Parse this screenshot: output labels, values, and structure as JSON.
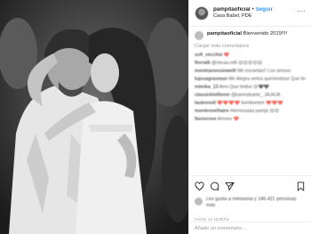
{
  "post": {
    "username": "pampitaoficial",
    "follow_label": "Seguir",
    "location": "Casa Babel, PDE",
    "caption_user": "pampitaoficial",
    "caption_text": "Bienvenido 2019!!!!",
    "load_more": "Cargar más comentarios",
    "likes_text": "Les gusta a mimaxina y 146.421 personas más",
    "timestamp": "HACE 11 HORAS",
    "comment_placeholder": "Añade un comentario..."
  },
  "comments": [
    {
      "user": "sofi_vecchio",
      "text": "❤️"
    },
    {
      "user": "florralli",
      "text": "@micaa.relli 😍😍😍😍😍"
    },
    {
      "user": "montepovosiowelll",
      "text": "Me encantan!! Los amooo"
    },
    {
      "user": "lujosagrasmun",
      "text": "Me Alegra verlos queriendose Que lindoo!! 🎉 felicidades!!!"
    },
    {
      "user": "mimika_13",
      "text": "Amo Que lindos 😍🖤🖤"
    },
    {
      "user": "classicklollieem",
      "text": "@karenduarte_ JAJAJA"
    },
    {
      "user": "lauleenoll",
      "text": "❤️❤️❤️❤️ bomboneer ❤️❤️❤️"
    },
    {
      "user": "montenoelhaire",
      "text": "Hermosaaa pareja 😍😍"
    },
    {
      "user": "favosrose",
      "text": "Amooo ❤️"
    }
  ],
  "icons": {
    "heart": "heart-icon",
    "comment": "comment-icon",
    "share": "share-icon",
    "save": "bookmark-icon",
    "more": "more-options-icon"
  },
  "colors": {
    "follow": "#3897f0",
    "text": "#262626",
    "muted": "#999999",
    "border": "#efefef"
  }
}
